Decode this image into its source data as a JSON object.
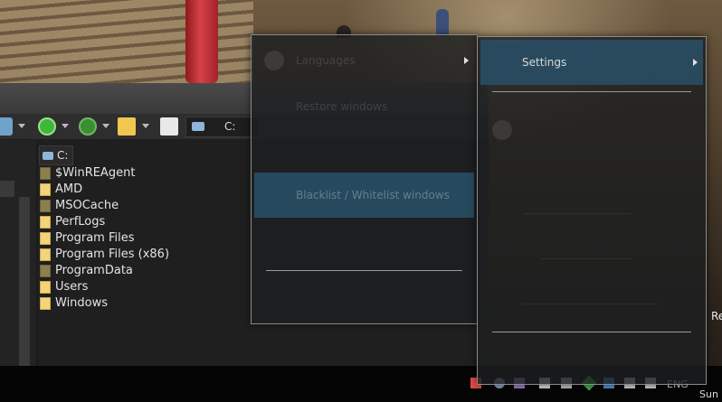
{
  "window": {
    "address_text": "C:",
    "breadcrumb": "C:"
  },
  "files": [
    {
      "name": "$WinREAgent",
      "hidden": true
    },
    {
      "name": "AMD",
      "hidden": false
    },
    {
      "name": "MSOCache",
      "hidden": true
    },
    {
      "name": "PerfLogs",
      "hidden": false
    },
    {
      "name": "Program Files",
      "hidden": false
    },
    {
      "name": "Program Files (x86)",
      "hidden": false
    },
    {
      "name": "ProgramData",
      "hidden": true
    },
    {
      "name": "Users",
      "hidden": false
    },
    {
      "name": "Windows",
      "hidden": false
    }
  ],
  "menu1": {
    "items": [
      {
        "label": "Languages",
        "submenu": true
      },
      {
        "label": "Restore windows",
        "submenu": false
      },
      {
        "label": "",
        "submenu": false
      },
      {
        "label": "Blacklist / Whitelist windows",
        "submenu": false,
        "highlighted": true
      }
    ]
  },
  "menu2": {
    "items": [
      {
        "label": "Settings",
        "submenu": true,
        "highlighted": true
      }
    ]
  },
  "taskbar": {
    "language": "ENG",
    "day": "Sun",
    "edge_text": "Re"
  },
  "colors": {
    "menu_highlight": "#294E64",
    "menu_border": "#8a8a8a",
    "taskbar": "#050505",
    "folder": "#f3d47a"
  }
}
